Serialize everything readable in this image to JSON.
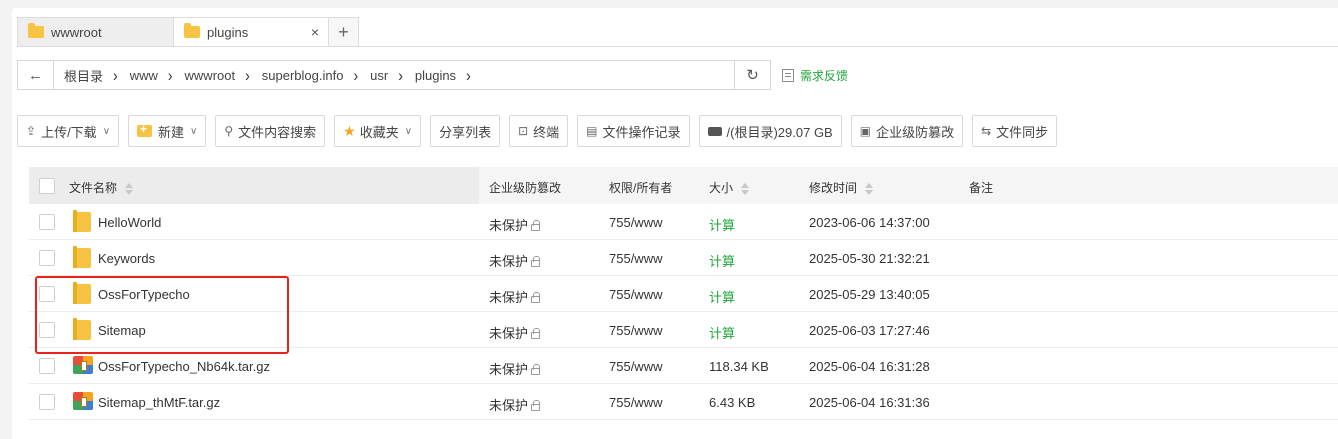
{
  "tabs": [
    {
      "label": "wwwroot",
      "active": false
    },
    {
      "label": "plugins",
      "active": true,
      "close": "×"
    }
  ],
  "tab_add": "+",
  "path": {
    "back_icon": "←",
    "crumbs": [
      "根目录",
      "www",
      "wwwroot",
      "superblog.info",
      "usr",
      "plugins"
    ],
    "separator": "›",
    "refresh_icon": "↻"
  },
  "feedback_label": "需求反馈",
  "toolbar": {
    "upload": "上传/下载",
    "new": "新建",
    "search_content": "文件内容搜索",
    "favorites": "收藏夹",
    "share_list": "分享列表",
    "terminal": "终端",
    "op_log": "文件操作记录",
    "disk": "/(根目录)29.07 GB",
    "tamper": "企业级防篡改",
    "sync": "文件同步"
  },
  "columns": {
    "name": "文件名称",
    "protect": "企业级防篡改",
    "perm": "权限/所有者",
    "size": "大小",
    "mtime": "修改时间",
    "note": "备注"
  },
  "files": [
    {
      "name": "HelloWorld",
      "type": "folder",
      "protect": "未保护",
      "perm": "755/www",
      "size": "计算",
      "mtime": "2023-06-06 14:37:00"
    },
    {
      "name": "Keywords",
      "type": "folder",
      "protect": "未保护",
      "perm": "755/www",
      "size": "计算",
      "mtime": "2025-05-30 21:32:21"
    },
    {
      "name": "OssForTypecho",
      "type": "folder",
      "protect": "未保护",
      "perm": "755/www",
      "size": "计算",
      "mtime": "2025-05-29 13:40:05"
    },
    {
      "name": "Sitemap",
      "type": "folder",
      "protect": "未保护",
      "perm": "755/www",
      "size": "计算",
      "mtime": "2025-06-03 17:27:46"
    },
    {
      "name": "OssForTypecho_Nb64k.tar.gz",
      "type": "archive",
      "protect": "未保护",
      "perm": "755/www",
      "size": "118.34 KB",
      "mtime": "2025-06-04 16:31:28"
    },
    {
      "name": "Sitemap_thMtF.tar.gz",
      "type": "archive",
      "protect": "未保护",
      "perm": "755/www",
      "size": "6.43 KB",
      "mtime": "2025-06-04 16:31:36"
    }
  ],
  "colors": {
    "accent_green": "#20a53a",
    "highlight_red": "#e8231d",
    "folder_yellow": "#f6c343"
  }
}
